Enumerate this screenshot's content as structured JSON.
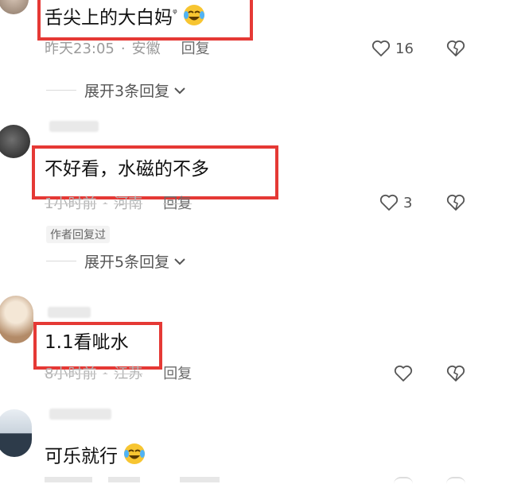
{
  "comments": [
    {
      "text": "舌尖上的大白妈",
      "small_mark": "ᵠ",
      "emoji": "laugh-cry-emoji",
      "time": "昨天23:05",
      "dot": "·",
      "location": "安徽",
      "reply": "回复",
      "likes": "16",
      "expand": "展开3条回复"
    },
    {
      "text": "不好看，水磁的不多",
      "time": "1小时前",
      "dot": "·",
      "location": "河南",
      "reply": "回复",
      "likes": "3",
      "author_tag": "作者回复过",
      "expand": "展开5条回复"
    },
    {
      "text": "1.1看呲水",
      "time": "8小时前",
      "dot": "·",
      "location": "江苏",
      "reply": "回复"
    },
    {
      "text": "可乐就行",
      "emoji": "laugh-cry-emoji"
    }
  ],
  "colors": {
    "highlight": "#e53935",
    "meta": "#9b9b9b",
    "text": "#111111"
  }
}
